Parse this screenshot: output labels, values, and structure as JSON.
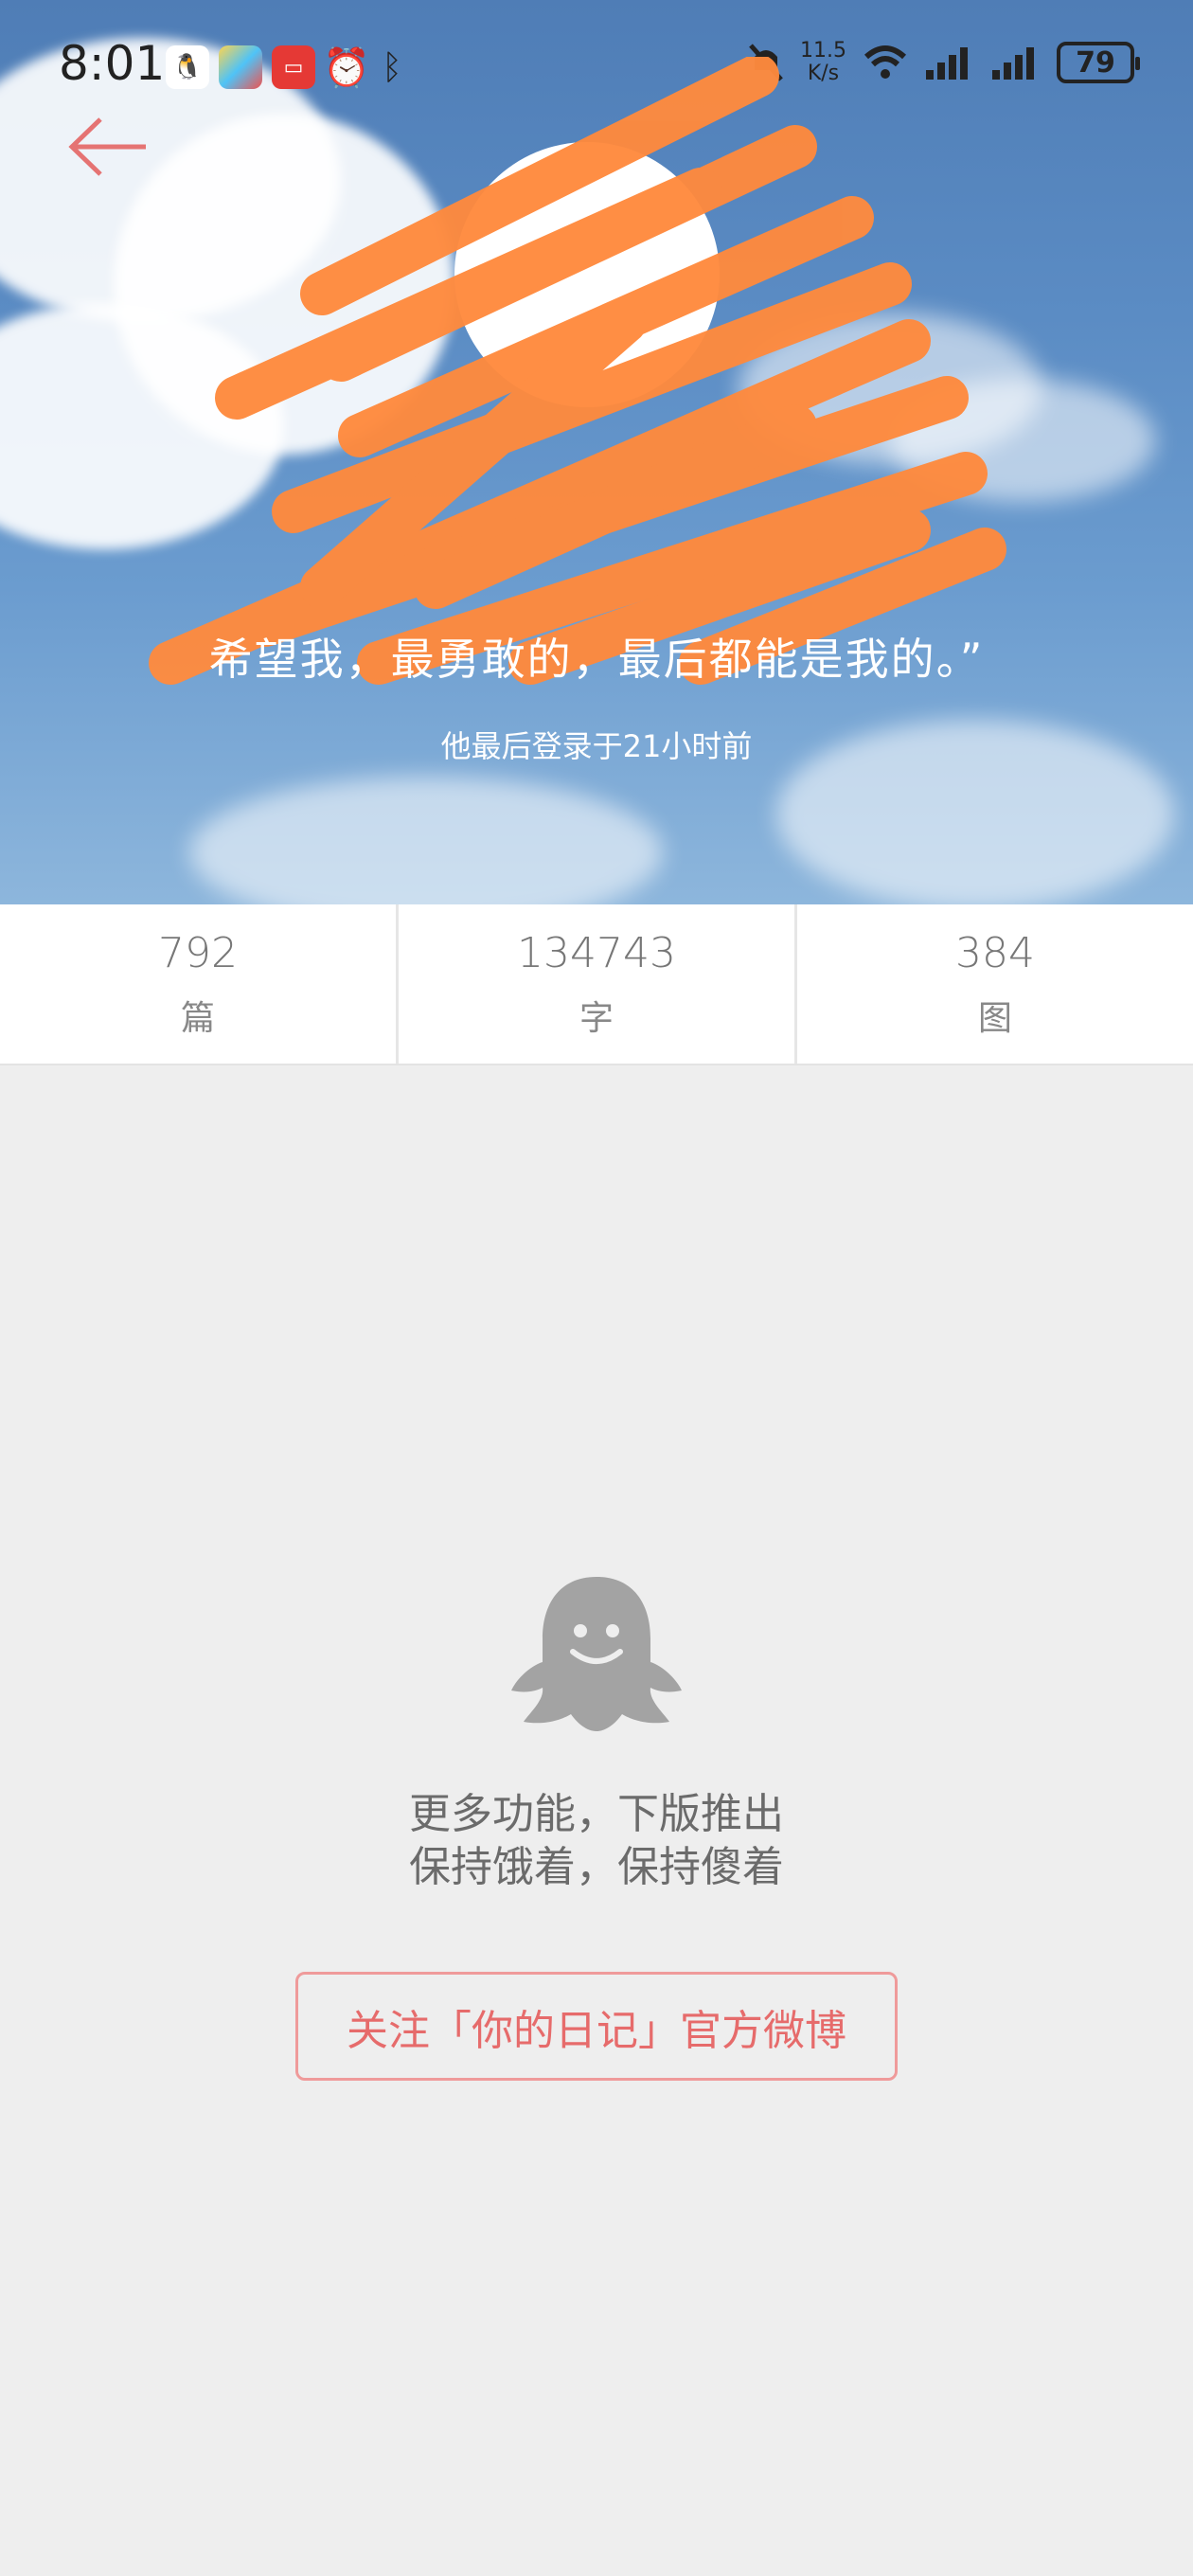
{
  "status_bar": {
    "time": "8:01",
    "network_speed_value": "11.5",
    "network_speed_unit": "K/s",
    "battery": "79",
    "icons": [
      "qq-icon",
      "app-icon",
      "reader-icon",
      "alarm-icon",
      "bluetooth-icon",
      "mute-icon",
      "wifi-icon",
      "signal-icon",
      "signal-icon-2"
    ]
  },
  "profile": {
    "motto": "希望我，最勇敢的，最后都能是我的。”",
    "last_login": "他最后登录于21小时前"
  },
  "stats": [
    {
      "value": "792",
      "label": "篇"
    },
    {
      "value": "134743",
      "label": "字"
    },
    {
      "value": "384",
      "label": "图"
    }
  ],
  "empty_state": {
    "icon": "ghost-icon",
    "line1": "更多功能，下版推出",
    "line2": "保持饿着，保持傻着"
  },
  "follow_button": {
    "label": "关注「你的日记」官方微博"
  },
  "colors": {
    "accent": "#e66b6b",
    "scribble": "#ff8a3d",
    "background": "#eeeeee"
  }
}
